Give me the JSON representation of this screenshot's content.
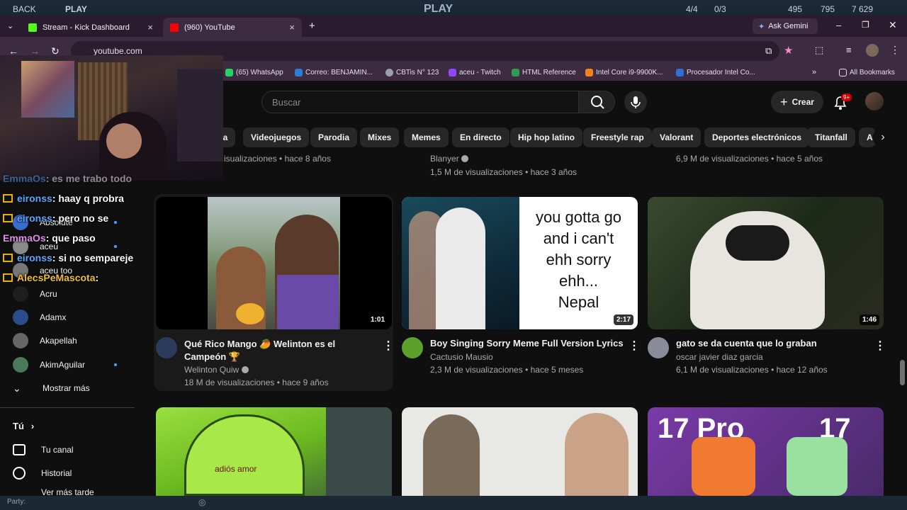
{
  "game_bar": {
    "back": "BACK",
    "play_left": "PLAY",
    "play_center": "PLAY",
    "stat1": "4/4",
    "stat2": "0/3",
    "stat3": "495",
    "stat4": "795",
    "stat5": "7 629"
  },
  "tabs": [
    {
      "label": "Stream - Kick Dashboard",
      "favicon_color": "#53fc18"
    },
    {
      "label": "(960) YouTube",
      "favicon_color": "#ff0000"
    }
  ],
  "ask_gemini": "Ask Gemini",
  "url": "youtube.com",
  "bookmarks": [
    {
      "label": "(65) WhatsApp",
      "color": "#25d366"
    },
    {
      "label": "Correo: BENJAMIN...",
      "color": "#2f7bd8"
    },
    {
      "label": "CBTis N° 123",
      "color": "#9aa0a6"
    },
    {
      "label": "aceu - Twitch",
      "color": "#9146ff"
    },
    {
      "label": "HTML Reference",
      "color": "#2e9b4f"
    },
    {
      "label": "Intel Core i9-9900K...",
      "color": "#f58220"
    },
    {
      "label": "Procesador Intel Co...",
      "color": "#2f6fd6"
    }
  ],
  "all_bookmarks": "All Bookmarks",
  "search_placeholder": "Buscar",
  "create_label": "Crear",
  "notif_badge": "9+",
  "chips": [
    "ca",
    "Videojuegos",
    "Parodia",
    "Mixes",
    "Memes",
    "En directo",
    "Hip hop latino",
    "Freestyle rap",
    "Valorant",
    "Deportes electrónicos",
    "Titanfall",
    "A"
  ],
  "sidebar": {
    "subs": [
      {
        "name": "Absolute"
      },
      {
        "name": "aceu"
      },
      {
        "name": "aceu too"
      },
      {
        "name": "Acru"
      },
      {
        "name": "Adamx"
      },
      {
        "name": "Akapellah"
      },
      {
        "name": "AkimAguilar"
      }
    ],
    "show_more": "Mostrar más",
    "you": "Tú",
    "your_channel": "Tu canal",
    "history": "Historial",
    "watch_later": "Ver más tarde"
  },
  "chat": [
    {
      "name": "EmmaOs",
      "msg": ": es me trabo todo"
    },
    {
      "name": "eironss",
      "msg": ": haay q probra"
    },
    {
      "name": "eironss",
      "msg": ": pero no se"
    },
    {
      "name": "EmmaOs",
      "msg": ": que paso"
    },
    {
      "name": "eironss",
      "msg": ": si no sempareje"
    },
    {
      "name": "AlecsPeMascota",
      "msg": ":"
    }
  ],
  "prev_row": [
    {
      "meta": "isualizaciones • hace 8 años"
    },
    {
      "channel": "Blanyer",
      "meta": "1,5 M de visualizaciones • hace 3 años"
    },
    {
      "meta": "6,9 M de visualizaciones • hace 5 años"
    }
  ],
  "videos": [
    {
      "title": "Qué Rico Mango 🥭 Welinton es el Campeón 🏆",
      "channel": "Welinton Quiw",
      "meta": "18 M de visualizaciones • hace 9 años",
      "duration": "1:01"
    },
    {
      "title": "Boy Singing Sorry Meme Full Version Lyrics",
      "channel": "Cactusio Mausio",
      "meta": "2,3 M de visualizaciones • hace 5 meses",
      "duration": "2:17",
      "thumb_text": [
        "you gotta go",
        "and  i  can't",
        "ehh sorry",
        "ehh...",
        "Nepal"
      ]
    },
    {
      "title": "gato se da cuenta que lo graban",
      "channel": "oscar javier diaz garcia",
      "meta": "6,1 M de visualizaciones • hace 12 años",
      "duration": "1:46"
    }
  ],
  "bottom_thumbs": {
    "t1_text": "adiós amor",
    "t3_text": "17 Pro",
    "t3_num": "17"
  },
  "status": "Party:"
}
